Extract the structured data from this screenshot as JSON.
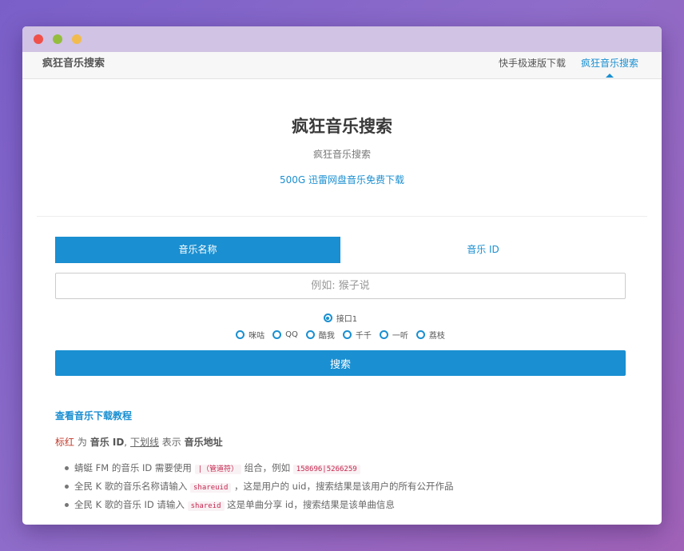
{
  "navbar": {
    "brand": "疯狂音乐搜索",
    "links": [
      {
        "label": "快手极速版下载"
      },
      {
        "label": "疯狂音乐搜索"
      }
    ]
  },
  "hero": {
    "title": "疯狂音乐搜索",
    "subtitle": "疯狂音乐搜索",
    "promo_link": "500G 迅雷网盘音乐免费下载"
  },
  "form": {
    "tabs": [
      {
        "label": "音乐名称"
      },
      {
        "label": "音乐 ID"
      }
    ],
    "search_placeholder": "例如: 猴子说",
    "interface_label": "接口1",
    "sources": [
      {
        "label": "咪咕"
      },
      {
        "label": "QQ"
      },
      {
        "label": "酷我"
      },
      {
        "label": "千千"
      },
      {
        "label": "一听"
      },
      {
        "label": "荔枝"
      }
    ],
    "search_button": "搜索"
  },
  "help": {
    "tutorial_link": "查看音乐下载教程",
    "legend": {
      "red_label": "标红",
      "is": "为",
      "music_id": "音乐 ID",
      "comma": ",",
      "underline_label": "下划线",
      "means": "表示",
      "music_url": "音乐地址"
    },
    "notes": [
      {
        "text": "蜻蜓 FM 的音乐 ID 需要使用",
        "code": "|（管道符）",
        "tail": "组合，例如",
        "code2": "158696|5266259"
      },
      {
        "text": "全民 K 歌的音乐名称请输入",
        "code": "shareuid",
        "tail": "，这是用户的 uid，搜索结果是该用户的所有公开作品"
      },
      {
        "text": "全民 K 歌的音乐 ID 请输入",
        "code": "shareid",
        "tail": "这是单曲分享 id，搜索结果是该单曲信息"
      }
    ]
  }
}
